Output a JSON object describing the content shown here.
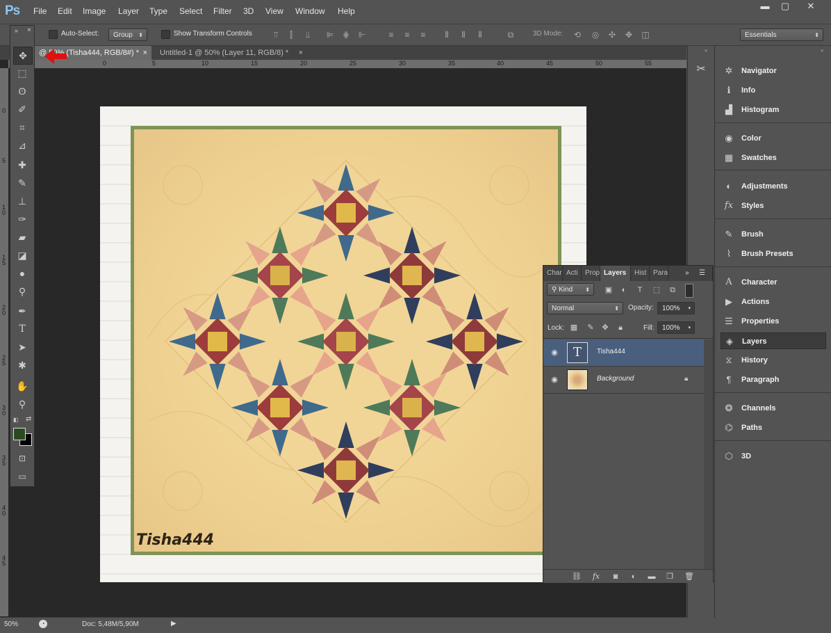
{
  "app": {
    "logo": "Ps"
  },
  "menu": [
    "File",
    "Edit",
    "Image",
    "Layer",
    "Type",
    "Select",
    "Filter",
    "3D",
    "View",
    "Window",
    "Help"
  ],
  "window_controls": {
    "minimize": "▬",
    "maximize": "▢",
    "close": "✕"
  },
  "options": {
    "auto_select_label": "Auto-Select:",
    "auto_select_mode": "Group",
    "show_transform_label": "Show Transform Controls",
    "mode_3d_label": "3D Mode:",
    "workspace": "Essentials"
  },
  "tabs": [
    {
      "label": "@ 50% (Tisha444, RGB/8#) *",
      "close": "×"
    },
    {
      "label": "Untitled-1 @ 50% (Layer 11, RGB/8) *",
      "close": "×"
    }
  ],
  "ruler": {
    "top": [
      "0",
      "5",
      "10",
      "15",
      "20",
      "25",
      "30",
      "35",
      "40",
      "45",
      "50",
      "55"
    ],
    "left": [
      "0",
      "5",
      "1\n0",
      "1\n5",
      "2\n0",
      "2\n5",
      "3\n0",
      "3\n5",
      "4\n0",
      "4\n5"
    ]
  },
  "canvas": {
    "watermark": "Tisha444"
  },
  "status": {
    "zoom": "50%",
    "doc": "Doc: 5,48M/5,90M"
  },
  "right_panels": [
    {
      "icon": "navigator-icon",
      "label": "Navigator",
      "glyph": "✲"
    },
    {
      "icon": "info-icon",
      "label": "Info",
      "glyph": "ℹ"
    },
    {
      "icon": "histogram-icon",
      "label": "Histogram",
      "glyph": "▟"
    },
    {
      "icon": "color-icon",
      "label": "Color",
      "glyph": "◉"
    },
    {
      "icon": "swatches-icon",
      "label": "Swatches",
      "glyph": "▦"
    },
    {
      "icon": "adjustments-icon",
      "label": "Adjustments",
      "glyph": "◐"
    },
    {
      "icon": "styles-icon",
      "label": "Styles",
      "glyph": "fx"
    },
    {
      "icon": "brush-icon",
      "label": "Brush",
      "glyph": "✎"
    },
    {
      "icon": "brush-presets-icon",
      "label": "Brush Presets",
      "glyph": "⌇"
    },
    {
      "icon": "character-icon",
      "label": "Character",
      "glyph": "A"
    },
    {
      "icon": "actions-icon",
      "label": "Actions",
      "glyph": "▶"
    },
    {
      "icon": "properties-icon",
      "label": "Properties",
      "glyph": "☰"
    },
    {
      "icon": "layers-icon",
      "label": "Layers",
      "glyph": "◈"
    },
    {
      "icon": "history-icon",
      "label": "History",
      "glyph": "⧖"
    },
    {
      "icon": "paragraph-icon",
      "label": "Paragraph",
      "glyph": "¶"
    },
    {
      "icon": "channels-icon",
      "label": "Channels",
      "glyph": "❂"
    },
    {
      "icon": "paths-icon",
      "label": "Paths",
      "glyph": "⌬"
    },
    {
      "icon": "3d-icon",
      "label": "3D",
      "glyph": "⬡"
    }
  ],
  "layers_panel": {
    "tabs": [
      "Char",
      "Acti",
      "Prop",
      "Layers",
      "Hist",
      "Para"
    ],
    "filter_kind": "Kind",
    "blend_mode": "Normal",
    "opacity_label": "Opacity:",
    "opacity": "100%",
    "lock_label": "Lock:",
    "fill_label": "Fill:",
    "fill": "100%",
    "layers": [
      {
        "name": "Tisha444",
        "type": "text",
        "selected": true,
        "visible": true
      },
      {
        "name": "Background",
        "type": "image",
        "selected": false,
        "visible": true,
        "locked": true
      }
    ]
  },
  "colors": {
    "accent": "#4a5f7e",
    "foreground": "#2b4a22",
    "background": "#000000",
    "arrow": "#e01010"
  }
}
